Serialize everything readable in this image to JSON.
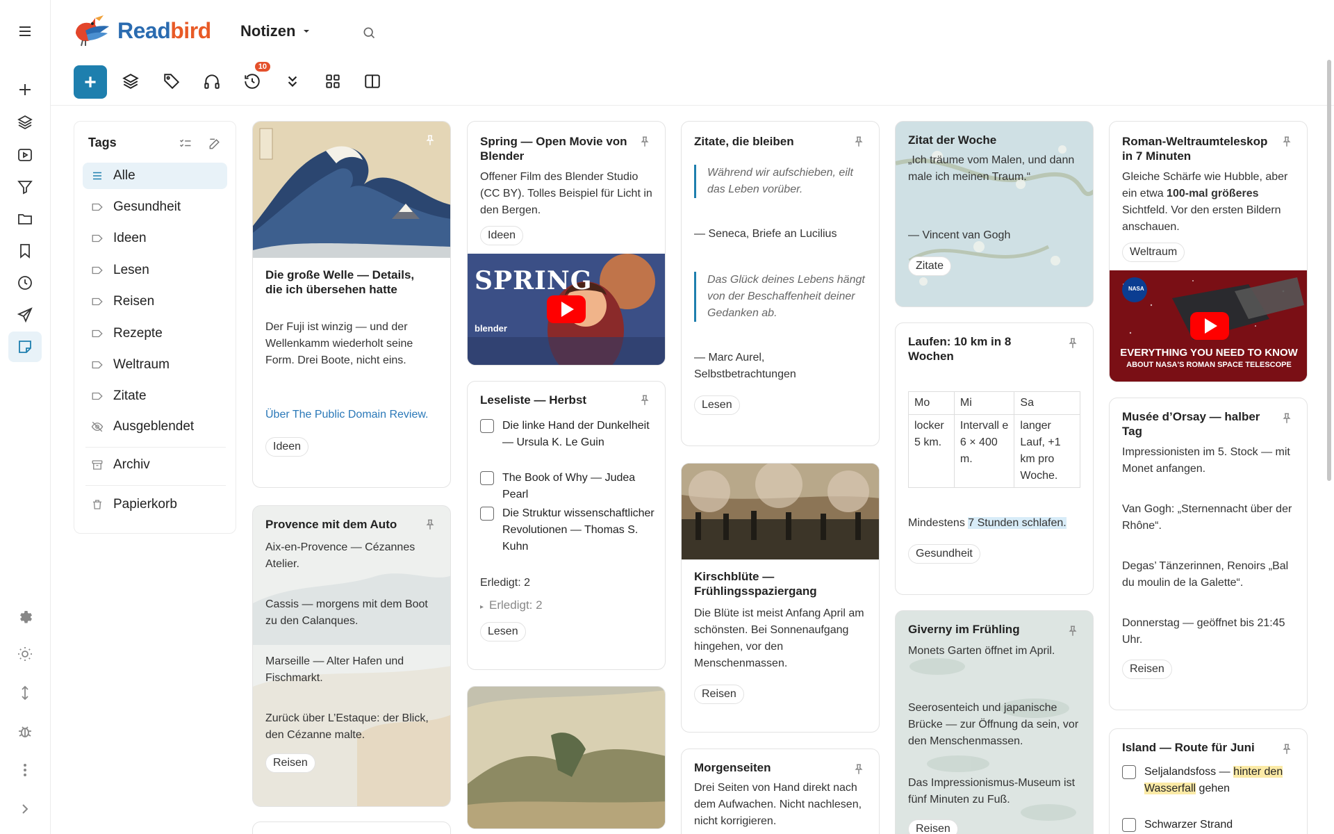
{
  "app": {
    "name_part1": "Read",
    "name_part2": "bird"
  },
  "header": {
    "view_title": "Notizen",
    "badge_count": "10"
  },
  "tags_panel": {
    "title": "Tags",
    "tags": [
      "Alle",
      "Gesundheit",
      "Ideen",
      "Lesen",
      "Reisen",
      "Rezepte",
      "Weltraum",
      "Zitate",
      "Ausgeblendet"
    ],
    "archive": "Archiv",
    "trash": "Papierkorb"
  },
  "cards": {
    "welle": {
      "title": "Die große Welle — Details, die ich übersehen hatte",
      "text": "Der Fuji ist winzig — und der Wellenkamm wiederholt seine Form. Drei Boote, nicht eins.",
      "link": "Über The Public Domain Review.",
      "tag": "Ideen"
    },
    "provence": {
      "title": "Provence mit dem Auto",
      "p1": "Aix-en-Provence — Cézannes Atelier.",
      "p2": "Cassis — morgens mit dem Boot zu den Calanques.",
      "p3": "Marseille — Alter Hafen und Fischmarkt.",
      "p4": "Zurück über L’Estaque: der Blick, den Cézanne malte.",
      "tag": "Reisen"
    },
    "spring": {
      "title": "Spring — Open Movie von Blender",
      "text": "Offener Film des Blender Studio (CC BY). Tolles Beispiel für Licht in den Bergen.",
      "tag": "Ideen",
      "video_title": "SPRING",
      "video_brand": "blender"
    },
    "leseliste": {
      "title": "Leseliste — Herbst",
      "items": [
        "Die linke Hand der Dunkelheit — Ursula K. Le Guin",
        "The Book of Why — Judea Pearl",
        "Die Struktur wissenschaftlicher Revolutionen — Thomas S. Kuhn"
      ],
      "done_count": "Erledigt: 2",
      "done_toggle": "Erledigt: 2",
      "tag": "Lesen"
    },
    "zitate": {
      "title": "Zitate, die bleiben",
      "q1": "Während wir aufschieben, eilt das Leben vorüber.",
      "a1": "— Seneca, Briefe an Lucilius",
      "q2": "Das Glück deines Lebens hängt von der Beschaffenheit deiner Gedanken ab.",
      "a2": "— Marc Aurel, Selbstbetrachtungen",
      "tag": "Lesen"
    },
    "kirsch": {
      "title": "Kirschblüte — Frühlingsspaziergang",
      "text": "Die Blüte ist meist Anfang April am schönsten. Bei Sonnenaufgang hingehen, vor den Menschenmassen.",
      "tag": "Reisen"
    },
    "morgen": {
      "title": "Morgenseiten",
      "text": "Drei Seiten von Hand direkt nach dem Aufwachen. Nicht nachlesen, nicht korrigieren."
    },
    "woche": {
      "title": "Zitat der Woche",
      "text": "„Ich träume vom Malen, und dann male ich meinen Traum.“",
      "author": "— Vincent van Gogh",
      "tag": "Zitate"
    },
    "laufen": {
      "title": "Laufen: 10 km in 8 Wochen",
      "table_head": [
        "Mo",
        "Mi",
        "Sa"
      ],
      "table_row": [
        "locker 5 km.",
        "Intervall e 6 × 400 m.",
        "langer Lauf, +1 km pro Woche."
      ],
      "sleep_pre": "Mindestens ",
      "sleep_hl": "7 Stunden schlafen.",
      "tag": "Gesundheit"
    },
    "giverny": {
      "title": "Giverny im Frühling",
      "p1": "Monets Garten öffnet im April.",
      "p2": "Seerosenteich und japanische Brücke — zur Öffnung da sein, vor den Menschenmassen.",
      "p3": "Das Impressionismus-Museum ist fünf Minuten zu Fuß.",
      "tag": "Reisen"
    },
    "roman": {
      "title": "Roman-Weltraumteleskop in 7 Minuten",
      "text_a": "Gleiche Schärfe wie Hubble, aber ein etwa ",
      "text_b": "100-mal größeres",
      "text_c": " Sichtfeld. Vor den ersten Bildern anschauen.",
      "tag": "Weltraum",
      "video_line1": "EVERYTHING YOU NEED TO KNOW",
      "video_line2": "ABOUT NASA'S ROMAN SPACE TELESCOPE",
      "video_brand": "NASA"
    },
    "orsay": {
      "title": "Musée d’Orsay — halber Tag",
      "p1": "Impressionisten im 5. Stock — mit Monet anfangen.",
      "p2": "Van Gogh: „Sternennacht über der Rhône“.",
      "p3": "Degas’ Tänzerinnen, Renoirs „Bal du moulin de la Galette“.",
      "p4": "Donnerstag — geöffnet bis 21:45 Uhr.",
      "tag": "Reisen"
    },
    "island": {
      "title": "Island — Route für Juni",
      "i1_pre": "Seljalandsfoss — ",
      "i1_hl": "hinter den Wasserfall",
      "i1_post": " gehen",
      "i2": "Schwarzer Strand"
    }
  }
}
